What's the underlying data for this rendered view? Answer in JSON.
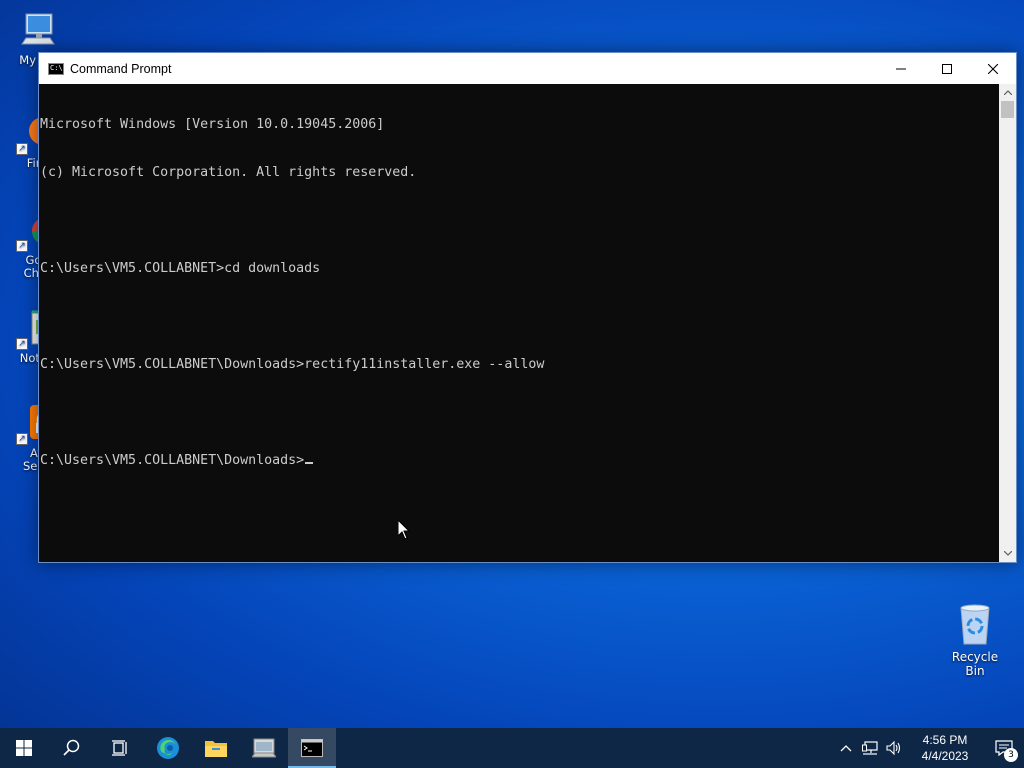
{
  "desktop": {
    "icons": [
      {
        "label": "My Co"
      },
      {
        "label": "Fire"
      },
      {
        "label": "Goo\nChro"
      },
      {
        "label": "Notep"
      },
      {
        "label": "Av\nSecu"
      }
    ],
    "recycle_bin": "Recycle Bin"
  },
  "window": {
    "title": "Command Prompt",
    "lines": [
      "Microsoft Windows [Version 10.0.19045.2006]",
      "(c) Microsoft Corporation. All rights reserved.",
      "",
      "C:\\Users\\VM5.COLLABNET>cd downloads",
      "",
      "C:\\Users\\VM5.COLLABNET\\Downloads>rectify11installer.exe --allow",
      "",
      "C:\\Users\\VM5.COLLABNET\\Downloads>"
    ]
  },
  "taskbar": {
    "time": "4:56 PM",
    "date": "4/4/2023",
    "notification_count": "3"
  }
}
